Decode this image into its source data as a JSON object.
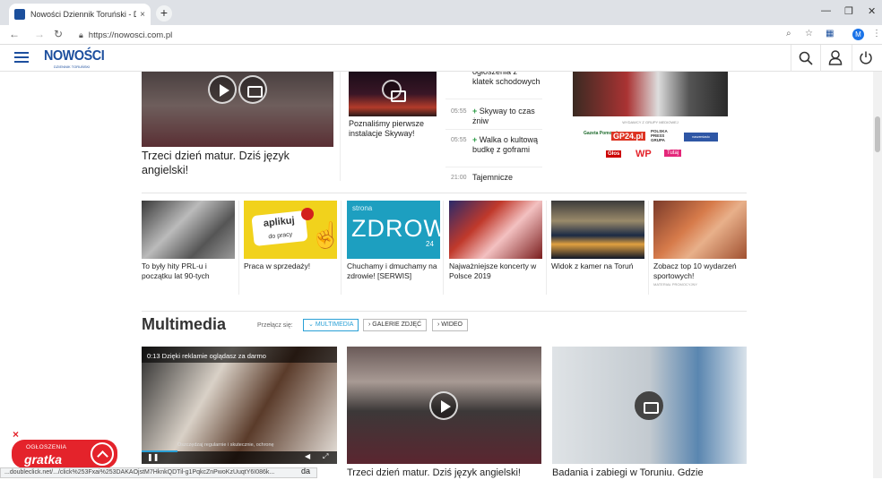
{
  "browser": {
    "tab_title": "Nowości Dziennik Toruński - Dzie",
    "tab_close": "×",
    "new_tab": "+",
    "url": "https://nowosci.com.pl",
    "profile_letter": "M",
    "status_url": "...doubleclick.net/.../click%253Fxai%253DAKAOjstM7HknkQDTil-g1PqkcZnPwoKzUuqtY6I086k...",
    "status_tail": "da"
  },
  "site": {
    "logo": "NOWOŚCI",
    "logo_sub": "DZIENNIK TORUŃSKI"
  },
  "top": {
    "main_headline": "Trzeci dzień matur. Dziś język angielski!",
    "second_headline": "Poznaliśmy pierwsze instalacje Skyway!",
    "news": [
      {
        "time": "",
        "plus": false,
        "text": "ogłoszenia z klatek schodowych"
      },
      {
        "time": "05:55",
        "plus": true,
        "text": "Skyway to czas żniw"
      },
      {
        "time": "05:55",
        "plus": true,
        "text": "Walka o kultową budkę z goframi"
      },
      {
        "time": "21:00",
        "plus": false,
        "text": "Tajemnicze"
      }
    ],
    "ad_caption": "WYDAWCY Z GRUPY MEDIOWEJ",
    "ad_logos": [
      "Gazeta Pomorska",
      "GP24.pl",
      "POLSKA PRESS GRUPA",
      "naszemiasto",
      "Głos",
      "WP",
      "Tutaj"
    ]
  },
  "tiles": [
    {
      "caption": "To były hity PRL-u i początku lat 90-tych",
      "promo": ""
    },
    {
      "caption": "Praca w sprzedaży!",
      "promo": "",
      "image_text": [
        "aplikuj",
        "do pracy"
      ]
    },
    {
      "caption": "Chuchamy i dmuchamy na zdrowie! [SERWIS]",
      "promo": "",
      "image_text": [
        "strona",
        "ZDROWIA",
        "24"
      ]
    },
    {
      "caption": "Najważniejsze koncerty w Polsce 2019",
      "promo": ""
    },
    {
      "caption": "Widok z kamer na Toruń",
      "promo": ""
    },
    {
      "caption": "Zobacz top 10 wydarzeń sportowych!",
      "promo": "MATERIAŁ PROMOCYJNY"
    }
  ],
  "multimedia": {
    "title": "Multimedia",
    "switch_label": "Przełącz się:",
    "buttons": [
      "MULTIMEDIA",
      "GALERIE ZDJĘĆ",
      "WIDEO"
    ],
    "video_overlay": "0:13 Dzięki reklamie oglądasz za darmo",
    "video_subtitle": "Oszczędzaj regularnie i skutecznie, ochronę",
    "headlines": [
      "Trzeci dzień matur. Dziś język angielski!",
      "Badania i zabiegi w Toruniu. Gdzie"
    ]
  },
  "ogloszenia": {
    "label": "OGŁOSZENIA",
    "brand": "gratka",
    "close": "×"
  },
  "colors": {
    "brand_blue": "#1d4f9e",
    "green_plus": "#2a9a44",
    "ad_red": "#e4232b",
    "active_button": "#2aa0d6"
  }
}
